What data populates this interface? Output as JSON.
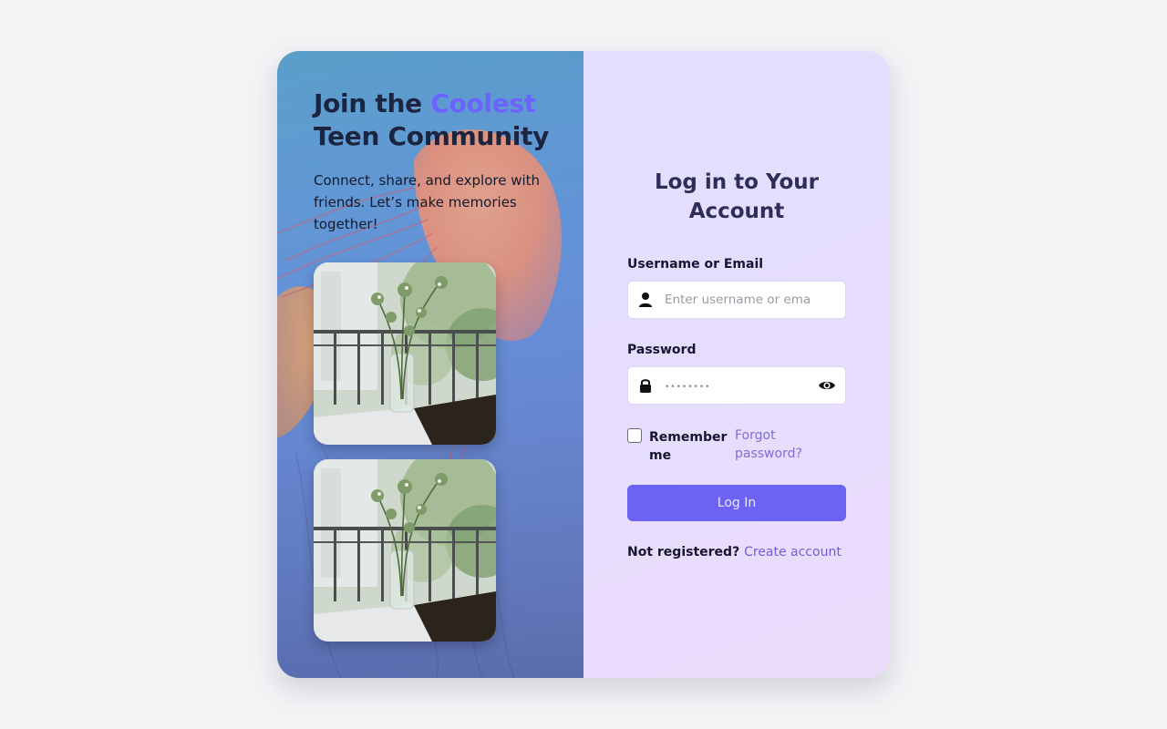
{
  "hero": {
    "title_prefix": "Join the ",
    "title_accent": "Coolest",
    "title_suffix": "Teen Community",
    "subtitle": "Connect, share, and explore with friends. Let’s make memories together!"
  },
  "gallery": {
    "photos": [
      {
        "subject": "flowers-in-glass-vase-on-balcony"
      },
      {
        "subject": "flowers-in-glass-vase-on-balcony"
      }
    ]
  },
  "login": {
    "title": "Log in to Your Account",
    "username_label": "Username or Email",
    "username_placeholder": "Enter username or email",
    "password_label": "Password",
    "password_placeholder": "••••••••",
    "remember_label": "Remember me",
    "forgot_label": "Forgot password?",
    "submit_label": "Log In",
    "register_prompt": "Not registered?",
    "register_link": "Create account"
  },
  "icons": {
    "username": "user-icon",
    "password": "lock-icon",
    "toggle": "eye-icon"
  },
  "colors": {
    "accent": "#6c63ff",
    "button": "#6c63f5",
    "link": "#7d6fd6",
    "title": "#2e2e5a",
    "page_bg": "#f2f3f5"
  }
}
